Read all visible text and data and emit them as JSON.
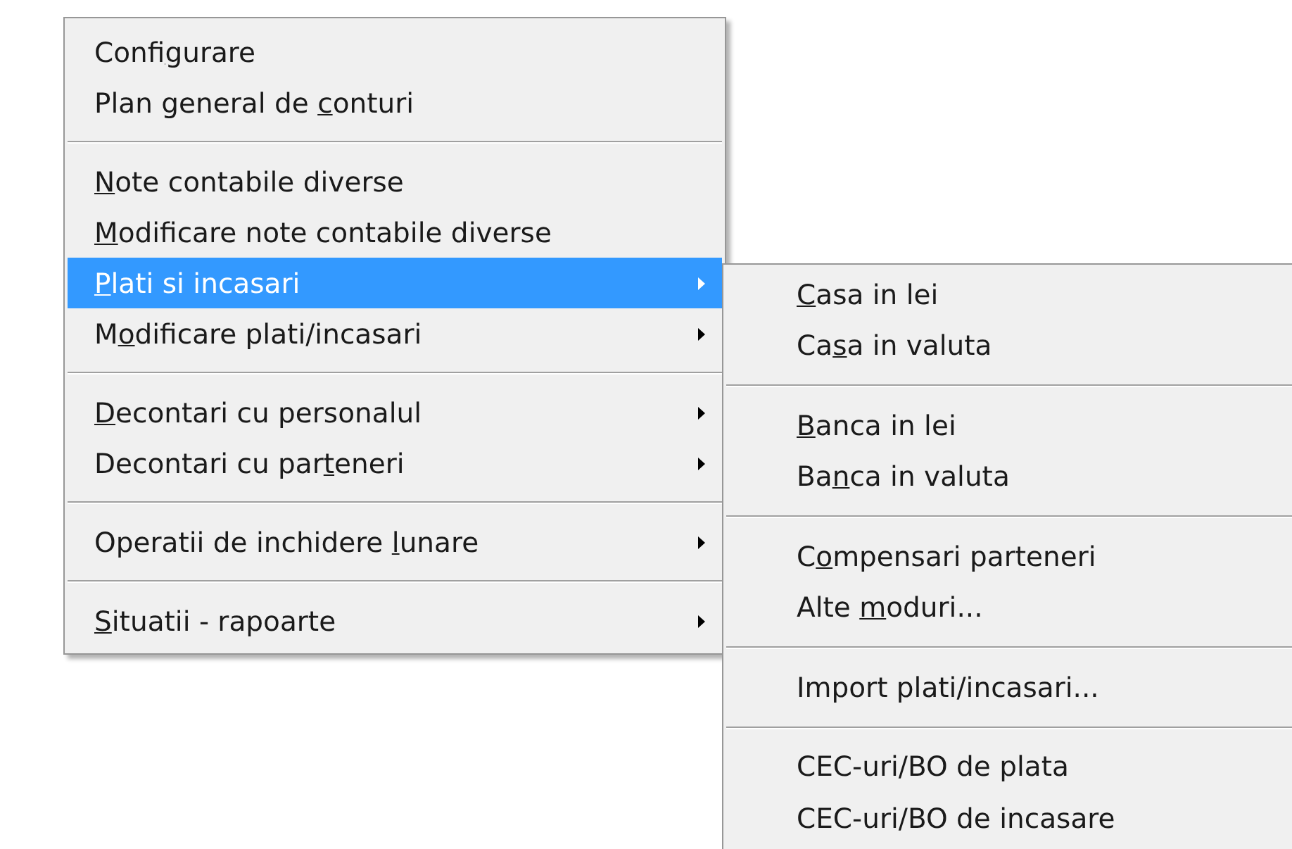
{
  "main_menu": {
    "groups": [
      [
        {
          "pre": "Confi",
          "key": "g",
          "post": "urare",
          "submenu": false,
          "selected": false
        },
        {
          "pre": "Plan general de ",
          "key": "c",
          "post": "onturi",
          "submenu": false,
          "selected": false
        }
      ],
      [
        {
          "key": "N",
          "post": "ote contabile diverse",
          "submenu": false,
          "selected": false
        },
        {
          "key": "M",
          "post": "odificare note contabile diverse",
          "submenu": false,
          "selected": false
        },
        {
          "key": "P",
          "post": "lati si incasari",
          "submenu": true,
          "selected": true
        },
        {
          "pre": "M",
          "key": "o",
          "post": "dificare plati/incasari",
          "submenu": true,
          "selected": false
        }
      ],
      [
        {
          "key": "D",
          "post": "econtari cu personalul",
          "submenu": true,
          "selected": false
        },
        {
          "pre": "Decontari cu par",
          "key": "t",
          "post": "eneri",
          "submenu": true,
          "selected": false
        }
      ],
      [
        {
          "pre": "Operatii de inchidere ",
          "key": "l",
          "post": "unare",
          "submenu": true,
          "selected": false
        }
      ],
      [
        {
          "key": "S",
          "post": "ituatii - rapoarte",
          "submenu": true,
          "selected": false
        }
      ]
    ]
  },
  "submenu": {
    "groups": [
      [
        {
          "key": "C",
          "post": "asa in lei"
        },
        {
          "pre": "Ca",
          "key": "s",
          "post": "a in valuta"
        }
      ],
      [
        {
          "key": "B",
          "post": "anca in lei"
        },
        {
          "pre": "Ba",
          "key": "n",
          "post": "ca in valuta"
        }
      ],
      [
        {
          "pre": "C",
          "key": "o",
          "post": "mpensari parteneri"
        },
        {
          "pre": "Alte ",
          "key": "m",
          "post": "oduri..."
        }
      ],
      [
        {
          "pre": "Import plati/incasari..."
        }
      ],
      [
        {
          "pre": "CEC-uri/BO de plata"
        },
        {
          "pre": "CEC-uri/BO de incasare"
        }
      ]
    ]
  }
}
